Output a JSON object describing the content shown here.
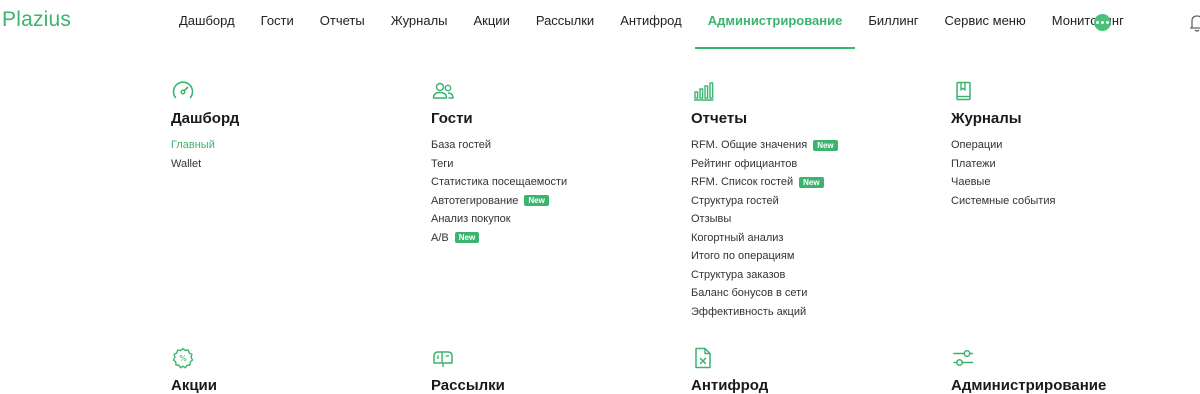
{
  "app": {
    "logo": "Plazius"
  },
  "nav": {
    "items": [
      {
        "label": "Дашборд",
        "active": false
      },
      {
        "label": "Гости",
        "active": false
      },
      {
        "label": "Отчеты",
        "active": false
      },
      {
        "label": "Журналы",
        "active": false
      },
      {
        "label": "Акции",
        "active": false
      },
      {
        "label": "Рассылки",
        "active": false
      },
      {
        "label": "Антифрод",
        "active": false
      },
      {
        "label": "Администрирование",
        "active": true
      },
      {
        "label": "Биллинг",
        "active": false
      },
      {
        "label": "Сервис меню",
        "active": false
      },
      {
        "label": "Мониторинг",
        "active": false
      }
    ],
    "more_icon": "ellipsis-icon",
    "bell_icon": "bell-icon"
  },
  "colors": {
    "accent": "#3bb46e"
  },
  "badge_text": "New",
  "sections": {
    "dashboard": {
      "icon": "speedometer-icon",
      "title": "Дашборд",
      "links": [
        {
          "label": "Главный",
          "current": true
        },
        {
          "label": "Wallet"
        }
      ]
    },
    "guests": {
      "icon": "users-icon",
      "title": "Гости",
      "links": [
        {
          "label": "База гостей"
        },
        {
          "label": "Теги"
        },
        {
          "label": "Статистика посещаемости"
        },
        {
          "label": "Автотегирование",
          "badge": "New"
        },
        {
          "label": "Анализ покупок"
        },
        {
          "label": "A/B",
          "badge": "New"
        }
      ]
    },
    "reports": {
      "icon": "bar-chart-icon",
      "title": "Отчеты",
      "links": [
        {
          "label": "RFM. Общие значения",
          "badge": "New"
        },
        {
          "label": "Рейтинг официантов"
        },
        {
          "label": "RFM. Список гостей",
          "badge": "New"
        },
        {
          "label": "Структура гостей"
        },
        {
          "label": "Отзывы"
        },
        {
          "label": "Когортный анализ"
        },
        {
          "label": "Итого по операциям"
        },
        {
          "label": "Структура заказов"
        },
        {
          "label": "Баланс бонусов в сети"
        },
        {
          "label": "Эффективность акций"
        }
      ]
    },
    "journals": {
      "icon": "journal-icon",
      "title": "Журналы",
      "links": [
        {
          "label": "Операции"
        },
        {
          "label": "Платежи"
        },
        {
          "label": "Чаевые"
        },
        {
          "label": "Системные события"
        }
      ]
    },
    "promotions": {
      "icon": "percent-badge-icon",
      "title": "Акции"
    },
    "mailings": {
      "icon": "mailbox-icon",
      "title": "Рассылки"
    },
    "antifraud": {
      "icon": "document-x-icon",
      "title": "Антифрод"
    },
    "admin": {
      "icon": "sliders-icon",
      "title": "Администрирование"
    }
  }
}
